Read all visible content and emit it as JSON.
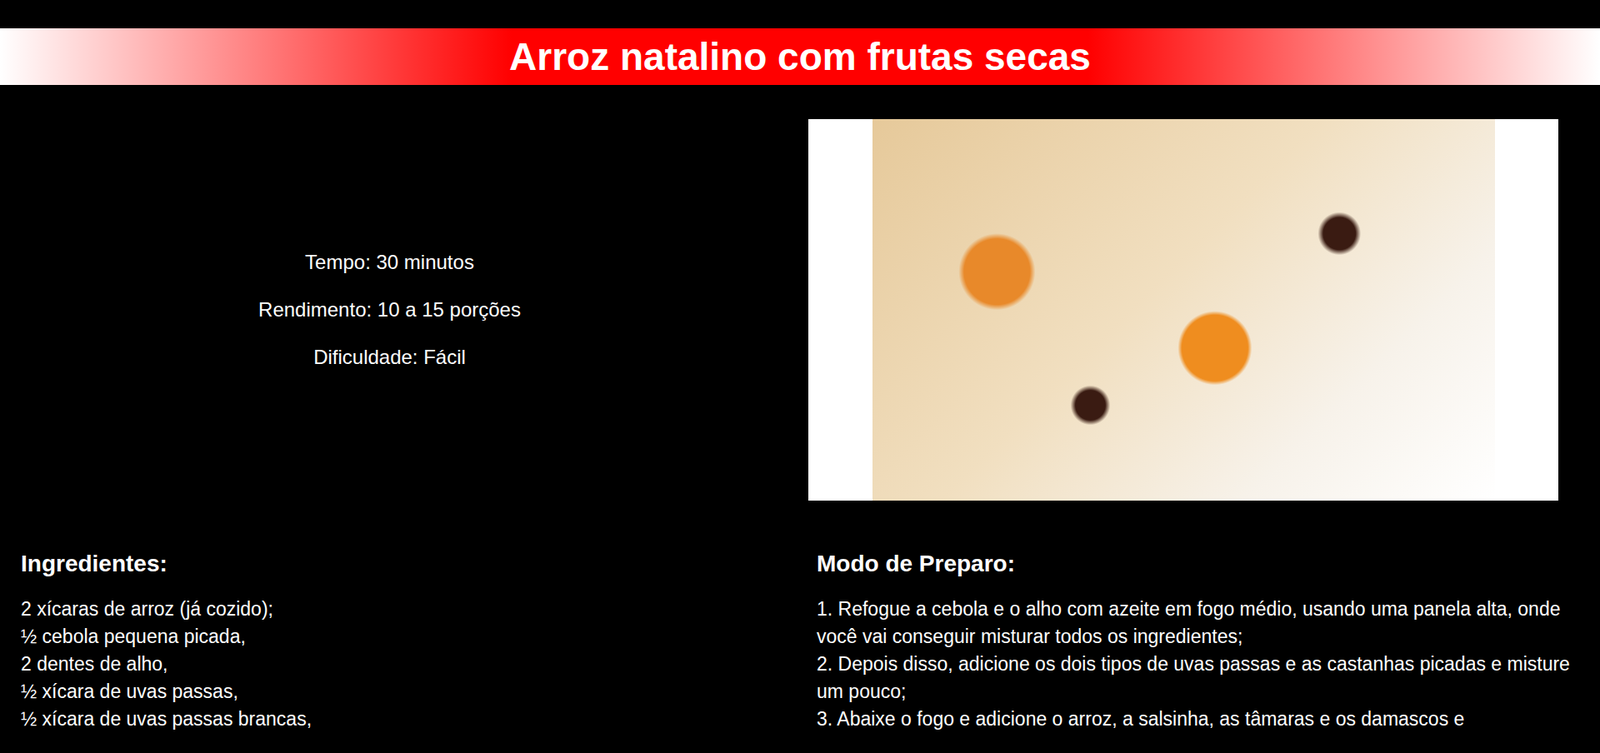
{
  "header": {
    "title": "Arroz natalino com frutas secas"
  },
  "info": [
    "Tempo: 30 minutos",
    "Rendimento: 10 a 15 porções",
    "Dificuldade: Fácil"
  ],
  "ingredients": {
    "heading": "Ingredientes:",
    "items": [
      "2 xícaras de arroz (já cozido);",
      "½ cebola pequena picada,",
      "2 dentes de alho,",
      "½ xícara de uvas passas,",
      "½ xícara de uvas passas brancas,"
    ]
  },
  "preparation": {
    "heading": "Modo de Preparo:",
    "steps": [
      "1. Refogue a cebola e o alho com azeite em fogo médio, usando uma panela alta, onde você vai conseguir misturar todos os ingredientes;",
      "2. Depois disso, adicione os dois tipos de uvas passas e as castanhas picadas e misture um pouco;",
      "3. Abaixe o fogo e adicione o arroz, a salsinha, as tâmaras e os damascos e"
    ]
  }
}
